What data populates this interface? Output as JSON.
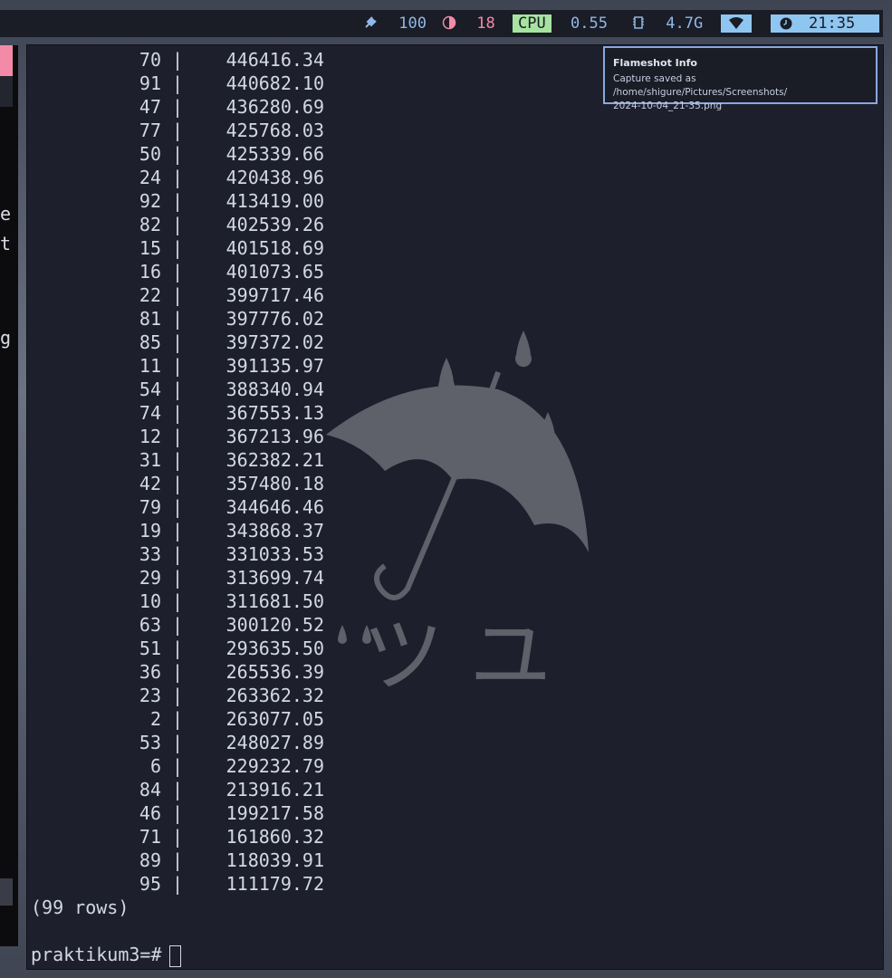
{
  "statusbar": {
    "power_icon": "plug-icon",
    "battery": "100",
    "brightness_icon": "contrast-icon",
    "brightness": "18",
    "cpu_label": "CPU",
    "cpu_value": "0.55",
    "mem_icon": "chip-icon",
    "memory": "4.7G",
    "wifi_icon": "wifi-icon",
    "clock_icon": "clock-icon",
    "time": "21:35",
    "colors": {
      "bar_bg": "#1a1c26",
      "accent_blue": "#8fc6f0",
      "accent_green": "#a6e3a1",
      "accent_pink": "#f38ba8"
    }
  },
  "left_window": {
    "chars": [
      "e",
      "t",
      "g"
    ]
  },
  "notification": {
    "title": "Flameshot Info",
    "line1": "Capture saved as /home/shigure/Pictures/Screenshots/",
    "line2": "2024-10-04_21-35.png"
  },
  "terminal": {
    "separator": "|",
    "rows": [
      {
        "id": "70",
        "value": "446416.34"
      },
      {
        "id": "91",
        "value": "440682.10"
      },
      {
        "id": "47",
        "value": "436280.69"
      },
      {
        "id": "77",
        "value": "425768.03"
      },
      {
        "id": "50",
        "value": "425339.66"
      },
      {
        "id": "24",
        "value": "420438.96"
      },
      {
        "id": "92",
        "value": "413419.00"
      },
      {
        "id": "82",
        "value": "402539.26"
      },
      {
        "id": "15",
        "value": "401518.69"
      },
      {
        "id": "16",
        "value": "401073.65"
      },
      {
        "id": "22",
        "value": "399717.46"
      },
      {
        "id": "81",
        "value": "397776.02"
      },
      {
        "id": "85",
        "value": "397372.02"
      },
      {
        "id": "11",
        "value": "391135.97"
      },
      {
        "id": "54",
        "value": "388340.94"
      },
      {
        "id": "74",
        "value": "367553.13"
      },
      {
        "id": "12",
        "value": "367213.96"
      },
      {
        "id": "31",
        "value": "362382.21"
      },
      {
        "id": "42",
        "value": "357480.18"
      },
      {
        "id": "79",
        "value": "344646.46"
      },
      {
        "id": "19",
        "value": "343868.37"
      },
      {
        "id": "33",
        "value": "331033.53"
      },
      {
        "id": "29",
        "value": "313699.74"
      },
      {
        "id": "10",
        "value": "311681.50"
      },
      {
        "id": "63",
        "value": "300120.52"
      },
      {
        "id": "51",
        "value": "293635.50"
      },
      {
        "id": "36",
        "value": "265536.39"
      },
      {
        "id": "23",
        "value": "263362.32"
      },
      {
        "id": "2",
        "value": "263077.05"
      },
      {
        "id": "53",
        "value": "248027.89"
      },
      {
        "id": "6",
        "value": "229232.79"
      },
      {
        "id": "84",
        "value": "213916.21"
      },
      {
        "id": "46",
        "value": "199217.58"
      },
      {
        "id": "71",
        "value": "161860.32"
      },
      {
        "id": "89",
        "value": "118039.91"
      },
      {
        "id": "95",
        "value": "111179.72"
      }
    ],
    "footer": "(99 rows)",
    "prompt": "praktikum3=#",
    "wallpaper_glyphs": "ツ ユ"
  }
}
